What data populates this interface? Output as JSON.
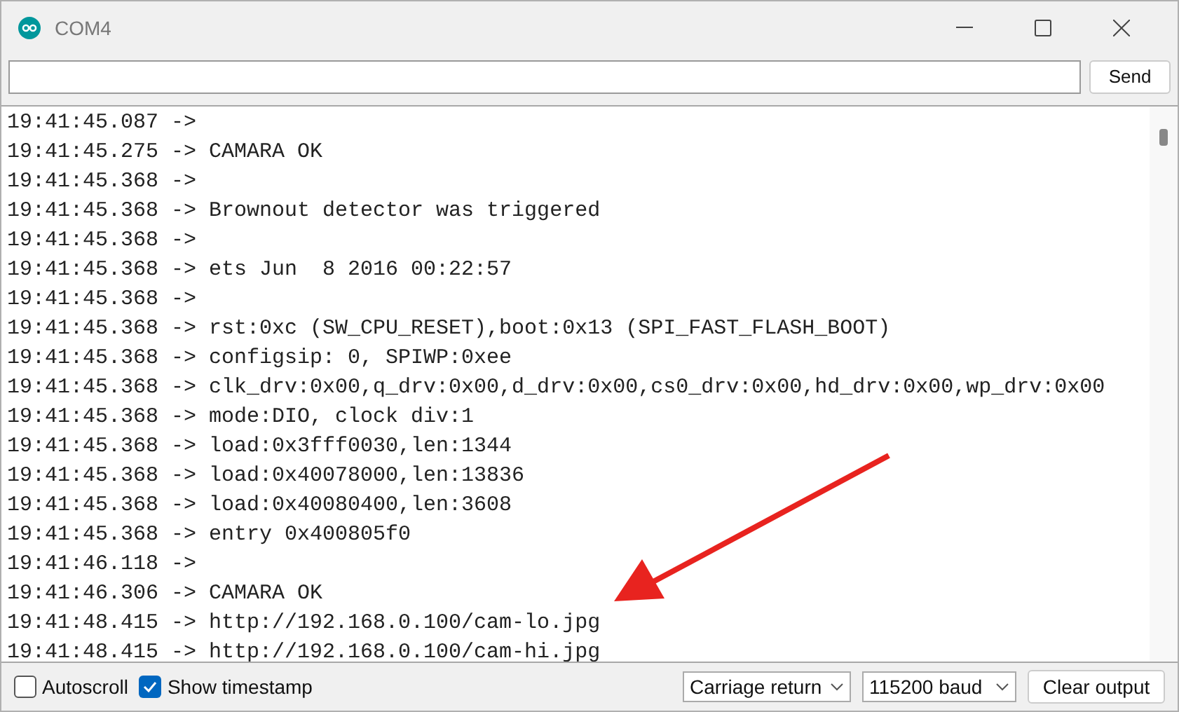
{
  "window": {
    "title": "COM4"
  },
  "send_button": "Send",
  "output": {
    "lines": [
      {
        "time": "19:41:45.087",
        "sep": "->"
      },
      {
        "time": "19:41:45.275",
        "sep": "->",
        "text": "CAMARA OK"
      },
      {
        "time": "19:41:45.368",
        "sep": "->"
      },
      {
        "time": "19:41:45.368",
        "sep": "->",
        "text": "Brownout detector was triggered"
      },
      {
        "time": "19:41:45.368",
        "sep": "->"
      },
      {
        "time": "19:41:45.368",
        "sep": "->",
        "text": "ets Jun  8 2016 00:22:57"
      },
      {
        "time": "19:41:45.368",
        "sep": "->"
      },
      {
        "time": "19:41:45.368",
        "sep": "->",
        "text": "rst:0xc (SW_CPU_RESET),boot:0x13 (SPI_FAST_FLASH_BOOT)"
      },
      {
        "time": "19:41:45.368",
        "sep": "->",
        "text": "configsip: 0, SPIWP:0xee"
      },
      {
        "time": "19:41:45.368",
        "sep": "->",
        "text": "clk_drv:0x00,q_drv:0x00,d_drv:0x00,cs0_drv:0x00,hd_drv:0x00,wp_drv:0x00"
      },
      {
        "time": "19:41:45.368",
        "sep": "->",
        "text": "mode:DIO, clock div:1"
      },
      {
        "time": "19:41:45.368",
        "sep": "->",
        "text": "load:0x3fff0030,len:1344"
      },
      {
        "time": "19:41:45.368",
        "sep": "->",
        "text": "load:0x40078000,len:13836"
      },
      {
        "time": "19:41:45.368",
        "sep": "->",
        "text": "load:0x40080400,len:3608"
      },
      {
        "time": "19:41:45.368",
        "sep": "->",
        "text": "entry 0x400805f0"
      },
      {
        "time": "19:41:46.118",
        "sep": "->"
      },
      {
        "time": "19:41:46.306",
        "sep": "->",
        "text": "CAMARA OK"
      },
      {
        "time": "19:41:48.415",
        "sep": "->",
        "text": "http://192.168.0.100/cam-lo.jpg"
      },
      {
        "time": "19:41:48.415",
        "sep": "->",
        "text": "http://192.168.0.100/cam-hi.jpg"
      }
    ]
  },
  "footer": {
    "checkboxes": [
      {
        "label": "Autoscroll",
        "checked": false
      },
      {
        "label": "Show timestamp",
        "checked": true
      }
    ],
    "line_ending": "Carriage return",
    "baud": "115200 baud",
    "clear_button": "Clear output"
  }
}
